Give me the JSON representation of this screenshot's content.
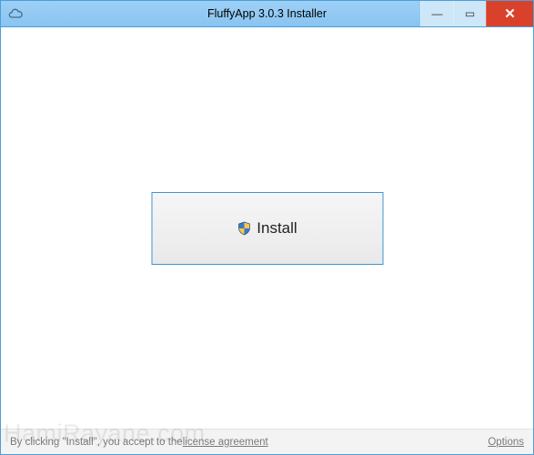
{
  "window": {
    "title": "FluffyApp 3.0.3 Installer",
    "app_icon": "cloud-icon"
  },
  "controls": {
    "minimize_glyph": "—",
    "maximize_glyph": "▭",
    "close_glyph": "✕"
  },
  "main": {
    "install_label": "Install"
  },
  "footer": {
    "prefix_text": "By clicking \"Install\", you accept to the ",
    "license_link_label": "license agreement",
    "options_label": "Options"
  },
  "watermark": "HamiRayane.com"
}
